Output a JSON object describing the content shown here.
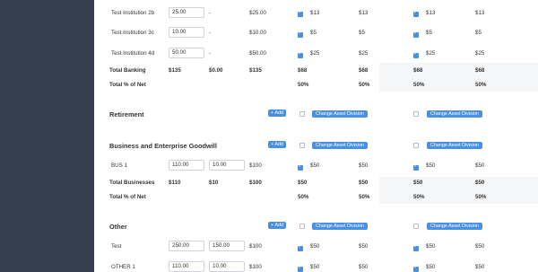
{
  "colors": {
    "sidebar": "#353f4f",
    "accent": "#4a90e2"
  },
  "top_rows": [
    {
      "name": "Test Institution 2b",
      "input": "25.00",
      "dash": "-",
      "amount": "$25.00",
      "c1": "$13",
      "c2": "$13",
      "c3": "$13",
      "c4": "$13"
    },
    {
      "name": "Test Institution 3c",
      "input": "10.00",
      "dash": "-",
      "amount": "$10.00",
      "c1": "$5",
      "c2": "$5",
      "c3": "$5",
      "c4": "$5"
    },
    {
      "name": "Test Institution 4d",
      "input": "50.00",
      "dash": "-",
      "amount": "$50.00",
      "c1": "$25",
      "c2": "$25",
      "c3": "$25",
      "c4": "$25"
    }
  ],
  "banking_total": {
    "label": "Total Banking",
    "a": "$135",
    "b": "$0.00",
    "c": "$135",
    "c1": "$68",
    "c2": "$68",
    "c3": "$68",
    "c4": "$68"
  },
  "banking_pct": {
    "label": "Total % of Net",
    "c1": "50%",
    "c2": "50%",
    "c3": "50%",
    "c4": "50%"
  },
  "retirement": {
    "title": "Retirement",
    "add": "+ Add",
    "cad": "Change Asset Division"
  },
  "business": {
    "title": "Business and Enterprise Goodwill",
    "add": "+ Add",
    "cad": "Change Asset Division",
    "row": {
      "name": "BUS 1",
      "in1": "110.00",
      "in2": "10.00",
      "amount": "$100",
      "c1": "$50",
      "c2": "$50",
      "c3": "$50",
      "c4": "$50"
    },
    "total": {
      "label": "Total Businesses",
      "a": "$110",
      "b": "$10",
      "c": "$100",
      "c1": "$50",
      "c2": "$50",
      "c3": "$50",
      "c4": "$50"
    },
    "pct": {
      "label": "Total % of Net",
      "c1": "50%",
      "c2": "50%",
      "c3": "50%",
      "c4": "50%"
    }
  },
  "other": {
    "title": "Other",
    "add": "+ Add",
    "cad": "Change Asset Division",
    "rows": [
      {
        "name": "Test",
        "in1": "250.00",
        "in2": "150.00",
        "amount": "$100",
        "c1": "$50",
        "c2": "$50",
        "c3": "$50",
        "c4": "$50"
      },
      {
        "name": "OTHER 1",
        "in1": "110.00",
        "in2": "10.00",
        "amount": "$100",
        "c1": "$50",
        "c2": "$50",
        "c3": "$50",
        "c4": "$50"
      }
    ]
  }
}
